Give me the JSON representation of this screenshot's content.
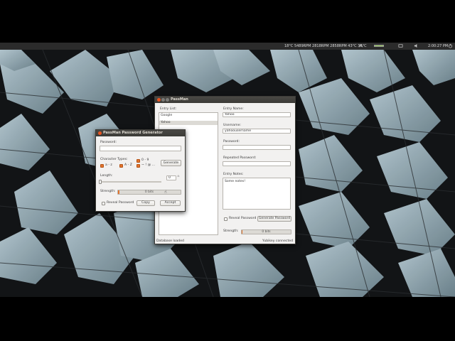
{
  "panel": {
    "indicator_text": "18°C 5489RPM 2818RPM 2858RPM 43°C 38°C",
    "clock": "2:00:27 PM"
  },
  "main_window": {
    "title": "PassMan",
    "entry_list_label": "Entry List:",
    "entries": [
      "Google",
      "Yahoo"
    ],
    "selected_entry_index": 1,
    "entry_name_label": "Entry Name:",
    "entry_name_value": "Yahoo",
    "username_label": "Username:",
    "username_value": "yahoousername",
    "password_label": "Password:",
    "password_value": "",
    "repeated_password_label": "Repeated Password:",
    "repeated_password_value": "",
    "entry_notes_label": "Entry Notes:",
    "entry_notes_value": "Some notes!",
    "reveal_password_label": "Reveal Password",
    "generate_password_label": "Generate Password",
    "strength_label": "Strength:",
    "strength_text": "0 bits",
    "strength_fraction": 0.02,
    "status_left": "Database loaded",
    "status_right": "Yubikey connected"
  },
  "generator_window": {
    "title": "PassMan Password Generator",
    "password_label": "Password:",
    "password_value": "",
    "character_types_label": "Character Types:",
    "char_types": [
      {
        "label": "a - z",
        "checked": true
      },
      {
        "label": "A - Z",
        "checked": true
      },
      {
        "label": "0 - 9",
        "checked": true
      },
      {
        "label": "~ ! @ ...",
        "checked": true
      }
    ],
    "generate_label": "Generate",
    "length_label": "Length:",
    "length_value": "0",
    "length_fraction": 0.0,
    "strength_label": "Strength:",
    "strength_text": "0 bits",
    "strength_fraction": 0.02,
    "reveal_password_label": "Reveal Password",
    "copy_label": "Copy",
    "accept_label": "Accept"
  },
  "colors": {
    "accent": "#e2742e",
    "titlebar": "#3c3b37",
    "window_bg": "#f2f1f0",
    "selection": "#dcdad5"
  },
  "icons": [
    "network-icon",
    "battery-icon",
    "volume-icon",
    "mail-icon",
    "power-icon",
    "mouse-cursor-icon"
  ]
}
